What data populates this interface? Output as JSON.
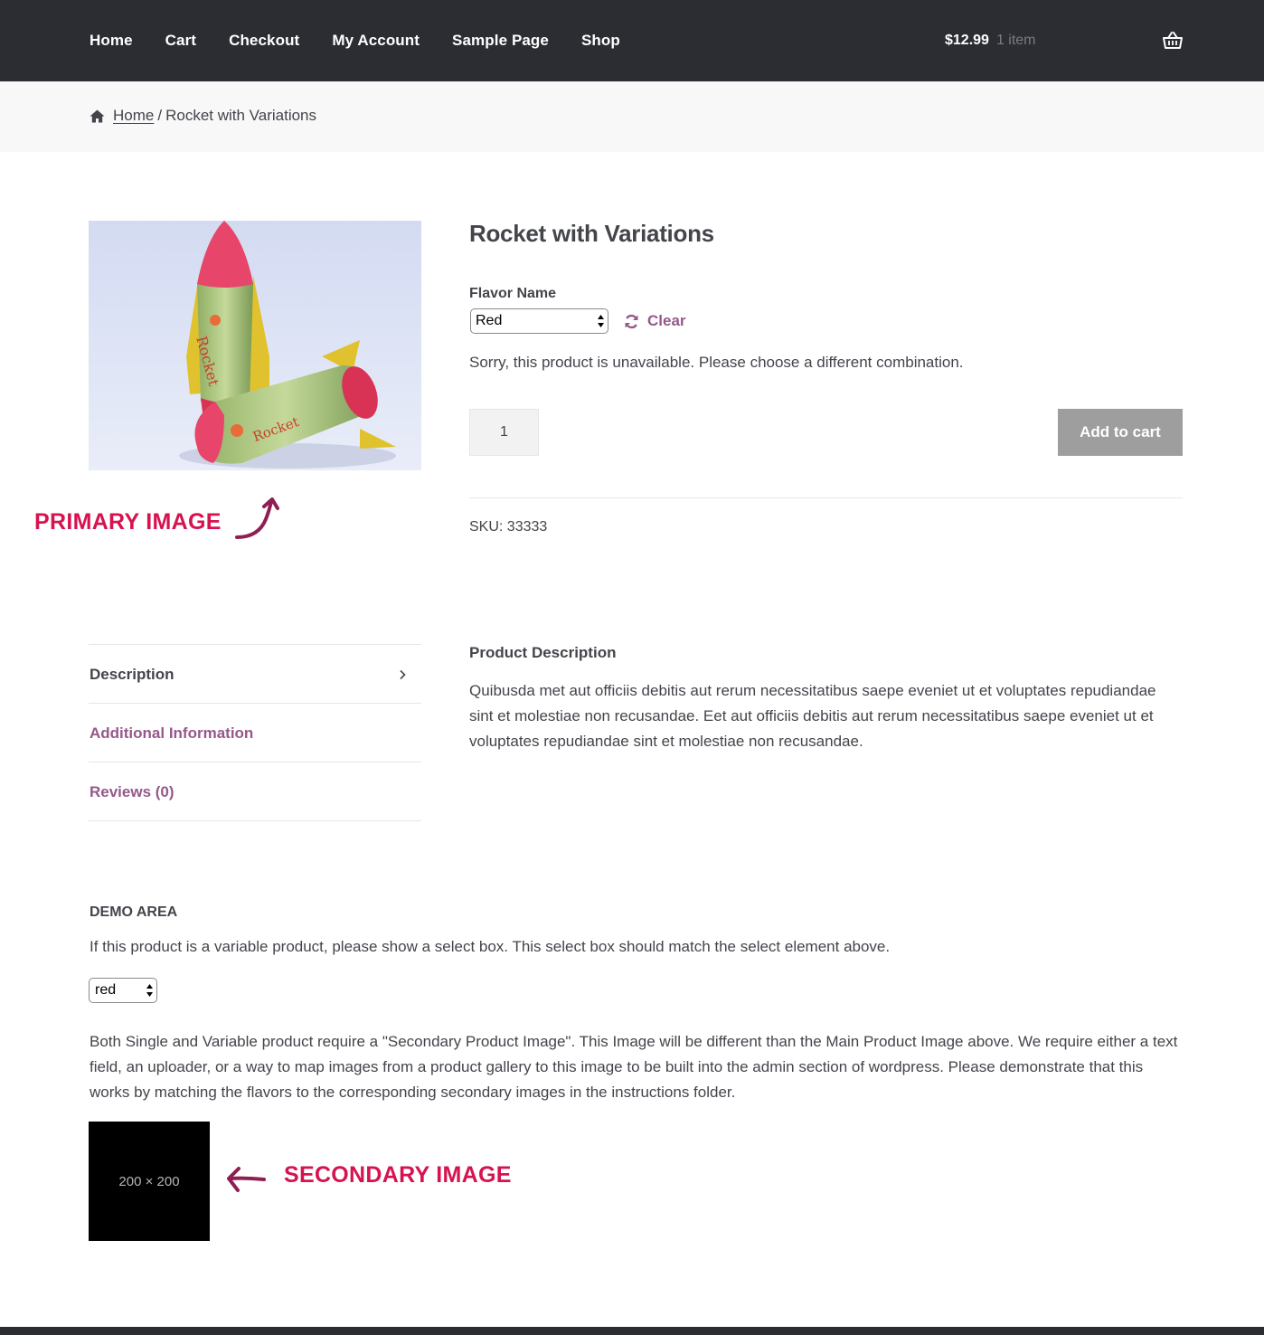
{
  "nav": {
    "items": [
      "Home",
      "Cart",
      "Checkout",
      "My Account",
      "Sample Page",
      "Shop"
    ]
  },
  "header_cart": {
    "amount": "$12.99",
    "count": "1 item",
    "icon": "basket-icon"
  },
  "breadcrumb": {
    "home_icon": "home-icon",
    "home": "Home",
    "separator": "/",
    "current": "Rocket with Variations"
  },
  "product": {
    "title": "Rocket with Variations",
    "flavor_label": "Flavor Name",
    "flavor_selected": "Red",
    "clear_label": "Clear",
    "unavailable_message": "Sorry, this product is unavailable. Please choose a different combination.",
    "quantity": "1",
    "add_to_cart": "Add to cart",
    "sku": "SKU: 33333"
  },
  "annotations": {
    "primary": "PRIMARY IMAGE",
    "secondary": "SECONDARY IMAGE"
  },
  "tabs": [
    {
      "label": "Description"
    },
    {
      "label": "Additional Information"
    },
    {
      "label": "Reviews (0)"
    }
  ],
  "description": {
    "heading": "Product Description",
    "body": "Quibusda met aut officiis debitis aut rerum necessitatibus saepe eveniet ut et voluptates repudiandae sint et molestiae non recusandae. Eet aut officiis debitis aut rerum necessitatibus saepe eveniet ut et voluptates repudiandae sint et molestiae non recusandae."
  },
  "demo": {
    "heading": "DEMO AREA",
    "instruction": "If this product is a variable product, please show a select box. This select box should match the select element above.",
    "select_value": "red",
    "paragraph": "Both Single and Variable product require a \"Secondary Product Image\". This Image will be different than the Main Product Image above. We require either a text field, an uploader, or a way to map images from a product gallery to this image to be built into the admin section of wordpress. Please demonstrate that this works by matching the flavors to the corresponding secondary images in the instructions folder.",
    "secondary_image_text": "200 × 200"
  },
  "colors": {
    "header_bg": "#2c2d33",
    "accent": "#96588a",
    "annotation": "#d6134f",
    "button_disabled": "#9e9e9e"
  }
}
